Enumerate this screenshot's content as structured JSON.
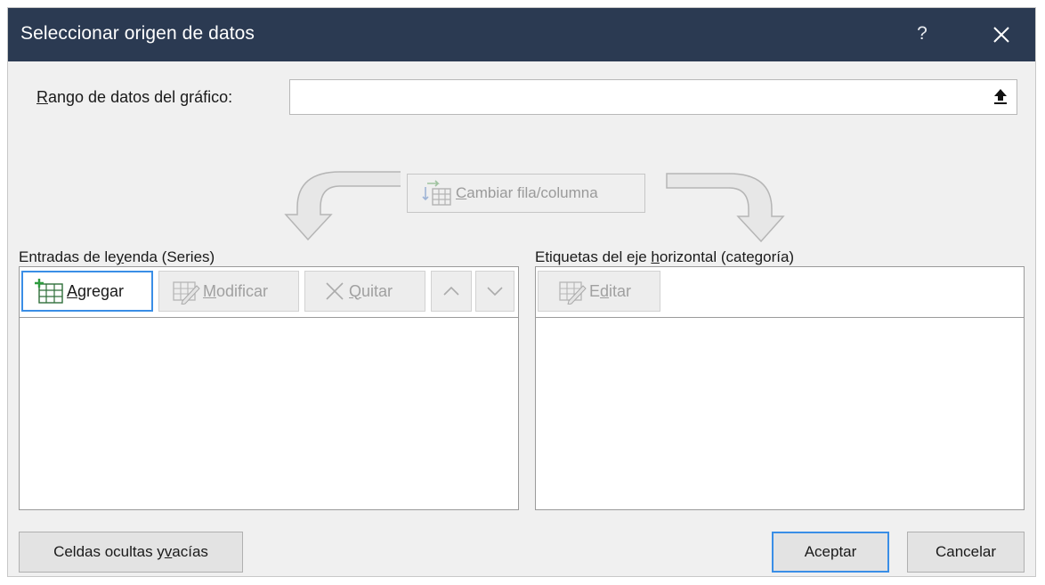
{
  "window": {
    "title": "Seleccionar origen de datos",
    "help_label": "?"
  },
  "range": {
    "label": "Rango de datos del gráfico:",
    "label_accel": "R",
    "label_rest": "ango de datos del gráfico:",
    "value": ""
  },
  "switch_button": {
    "accel": "C",
    "rest": "ambiar fila/columna",
    "enabled": false
  },
  "series_panel": {
    "label_pre": "Entradas de le",
    "label_accel": "y",
    "label_post": "enda (Series)",
    "buttons": {
      "add": {
        "accel": "A",
        "rest": "gregar",
        "enabled": true
      },
      "edit": {
        "accel": "M",
        "rest": "odificar",
        "enabled": false
      },
      "remove": {
        "accel": "Q",
        "rest": "uitar",
        "enabled": false
      },
      "move_up": {
        "enabled": false
      },
      "move_down": {
        "enabled": false
      }
    },
    "items": []
  },
  "category_panel": {
    "label_pre": "Etiquetas del eje ",
    "label_accel": "h",
    "label_post": "orizontal (categoría)",
    "buttons": {
      "edit": {
        "pre": "E",
        "accel": "d",
        "post": "itar",
        "enabled": false
      }
    },
    "items": []
  },
  "footer": {
    "hidden_cells_pre": "Celdas ocultas y ",
    "hidden_cells_accel": "v",
    "hidden_cells_post": "acías",
    "ok_label": "Aceptar",
    "cancel_label": "Cancelar"
  },
  "colors": {
    "titlebar": "#2b3a52",
    "dialog_bg": "#f0f0f0",
    "focus_border": "#3a8ee6",
    "disabled_text": "#a0a0a0"
  }
}
